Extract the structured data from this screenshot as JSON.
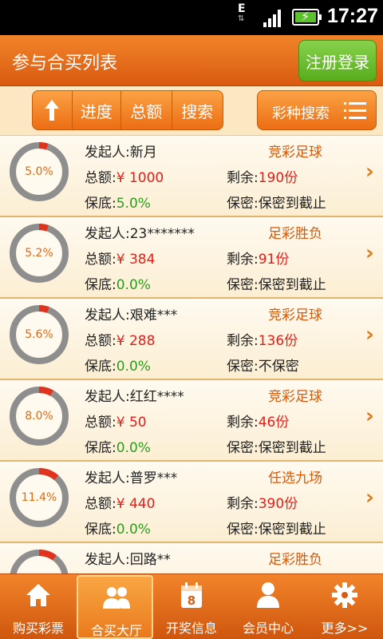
{
  "status_bar": {
    "network": "E",
    "time": "17:27"
  },
  "header": {
    "title": "参与合买列表",
    "login_label": "注册登录"
  },
  "filter": {
    "progress_label": "进度",
    "total_label": "总额",
    "search_label": "搜索",
    "type_search_label": "彩种搜索"
  },
  "labels": {
    "initiator": "发起人:",
    "total": "总额:",
    "currency": "¥",
    "remaining": "剩余:",
    "unit": "份",
    "guarantee": "保底:",
    "privacy": "保密:"
  },
  "items": [
    {
      "progress": "5.0%",
      "progress_value": 5.0,
      "initiator": "新月",
      "lottery": "竞彩足球",
      "amount": "1000",
      "remaining": "190",
      "guarantee": "5.0%",
      "privacy": "保密到截止"
    },
    {
      "progress": "5.2%",
      "progress_value": 5.2,
      "initiator": "23*******",
      "lottery": "足彩胜负",
      "amount": "384",
      "remaining": "91",
      "guarantee": "0.0%",
      "privacy": "保密到截止"
    },
    {
      "progress": "5.6%",
      "progress_value": 5.6,
      "initiator": "艰难***",
      "lottery": "竞彩足球",
      "amount": "288",
      "remaining": "136",
      "guarantee": "0.0%",
      "privacy": "不保密"
    },
    {
      "progress": "8.0%",
      "progress_value": 8.0,
      "initiator": "红红****",
      "lottery": "竞彩足球",
      "amount": "50",
      "remaining": "46",
      "guarantee": "0.0%",
      "privacy": "保密到截止"
    },
    {
      "progress": "11.4%",
      "progress_value": 11.4,
      "initiator": "普罗***",
      "lottery": "任选九场",
      "amount": "440",
      "remaining": "390",
      "guarantee": "0.0%",
      "privacy": "保密到截止"
    },
    {
      "progress": "",
      "progress_value": 10.0,
      "initiator": "回路**",
      "lottery": "足彩胜负",
      "amount": "",
      "remaining": "",
      "guarantee": "",
      "privacy": ""
    }
  ],
  "nav": [
    {
      "label": "购买彩票",
      "icon": "home-icon",
      "active": false
    },
    {
      "label": "合买大厅",
      "icon": "group-icon",
      "active": true
    },
    {
      "label": "开奖信息",
      "icon": "calendar-icon",
      "active": false
    },
    {
      "label": "会员中心",
      "icon": "user-icon",
      "active": false
    },
    {
      "label": "更多>>",
      "icon": "gear-icon",
      "active": false
    }
  ],
  "colors": {
    "accent": "#ec6d12",
    "money": "#e0201c",
    "guarantee": "#2e9b1e",
    "login_button": "#58ad1c"
  }
}
